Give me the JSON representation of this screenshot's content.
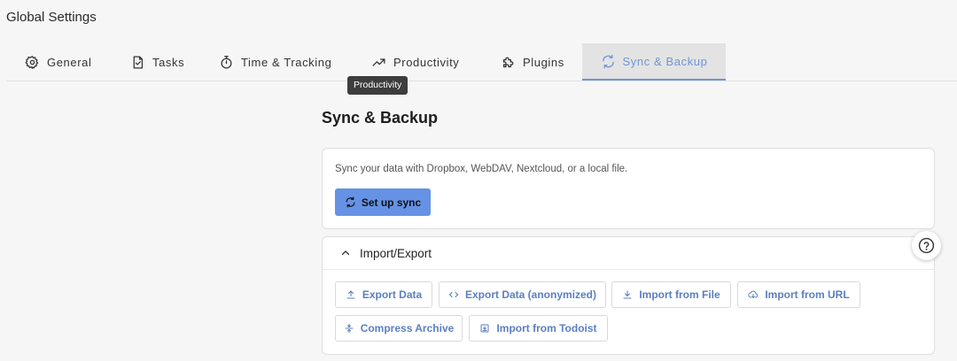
{
  "window": {
    "title": "Global Settings"
  },
  "tabs": [
    {
      "label": "General",
      "icon": "gear-icon"
    },
    {
      "label": "Tasks",
      "icon": "task-check-icon"
    },
    {
      "label": "Time & Tracking",
      "icon": "stopwatch-icon"
    },
    {
      "label": "Productivity",
      "icon": "trending-up-icon"
    },
    {
      "label": "Plugins",
      "icon": "puzzle-icon"
    },
    {
      "label": "Sync & Backup",
      "icon": "sync-icon",
      "active": true
    }
  ],
  "tooltip": {
    "text": "Productivity"
  },
  "section": {
    "title": "Sync & Backup"
  },
  "sync": {
    "description": "Sync your data with Dropbox, WebDAV, Nextcloud, or a local file.",
    "setup_label": "Set up sync"
  },
  "import_export": {
    "title": "Import/Export",
    "expanded": true,
    "buttons": [
      {
        "label": "Export Data",
        "icon": "upload-icon"
      },
      {
        "label": "Export Data (anonymized)",
        "icon": "code-icon"
      },
      {
        "label": "Import from File",
        "icon": "download-icon"
      },
      {
        "label": "Import from URL",
        "icon": "cloud-download-icon"
      },
      {
        "label": "Compress Archive",
        "icon": "compress-icon"
      },
      {
        "label": "Import from Todoist",
        "icon": "import-box-icon"
      }
    ]
  },
  "help": {
    "icon": "help-circle-icon"
  },
  "colors": {
    "accent": "#6f95d6",
    "primary_button": "#6592e4",
    "link_text": "#5b7fc1"
  }
}
